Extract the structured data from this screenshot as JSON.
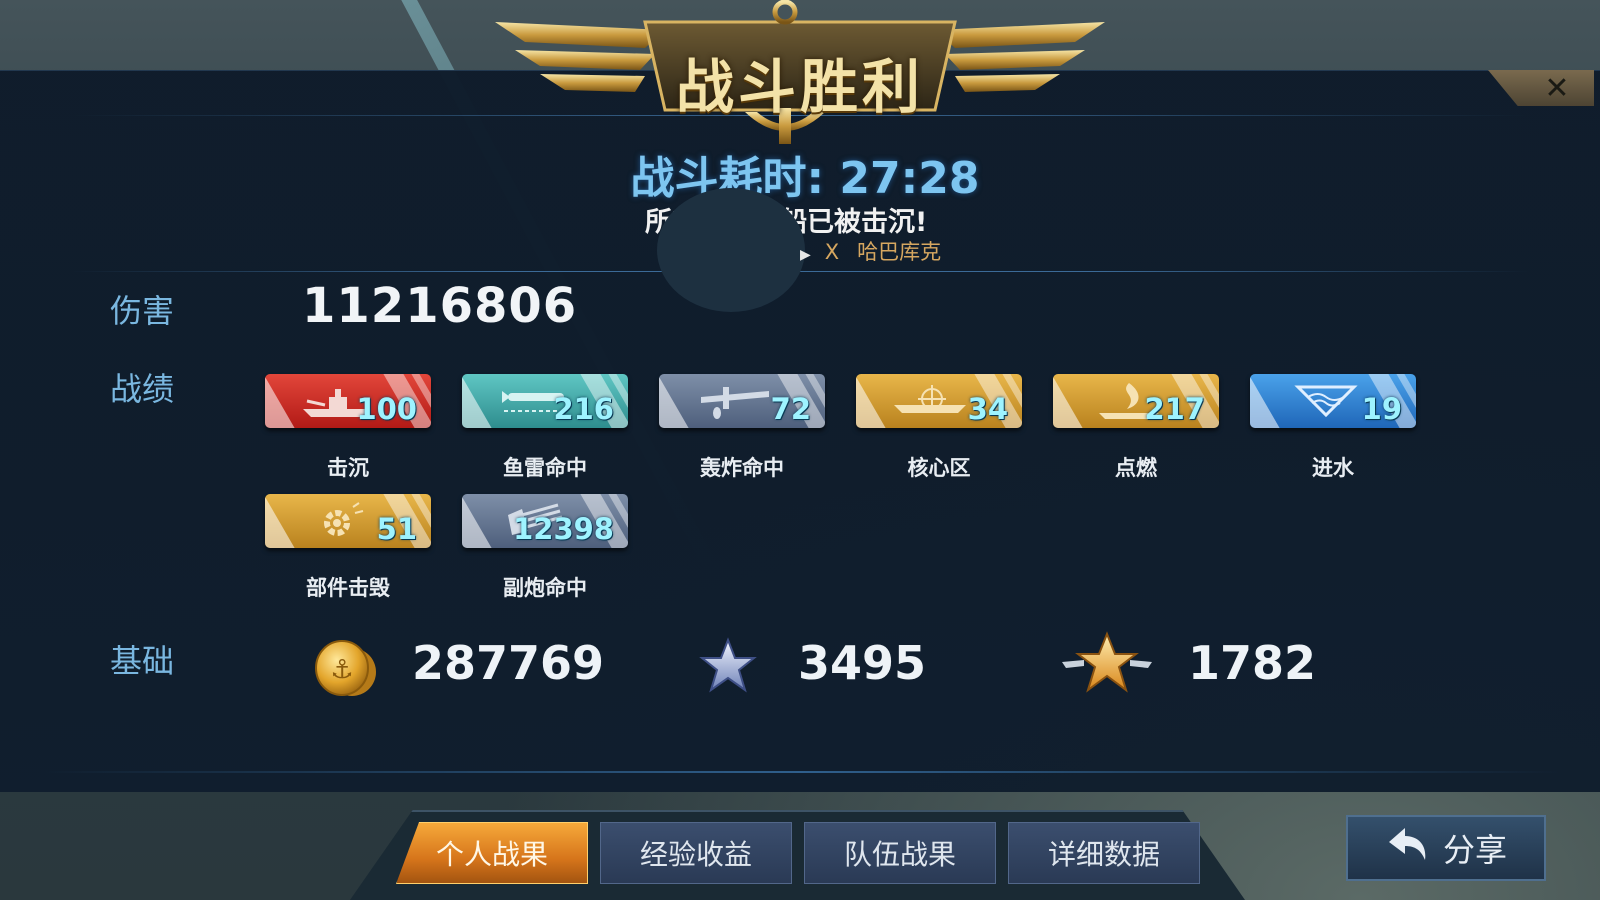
{
  "header": {
    "title": "战斗胜利",
    "duration_text": "战斗耗时: 27:28",
    "sunk_message": "所有敌方舰船已被击沉!",
    "kill_marker": "X",
    "kill_name": "哈巴库克"
  },
  "damage": {
    "label": "伤害",
    "value": "11216806"
  },
  "record": {
    "label": "战绩",
    "badges": [
      {
        "value": "100",
        "caption": "击沉",
        "icon": "warship-icon",
        "color": "#c9302a"
      },
      {
        "value": "216",
        "caption": "鱼雷命中",
        "icon": "torpedo-icon",
        "color": "#3fa5a5"
      },
      {
        "value": "72",
        "caption": "轰炸命中",
        "icon": "bomber-icon",
        "color": "#62738f"
      },
      {
        "value": "34",
        "caption": "核心区",
        "icon": "core-zone-icon",
        "color": "#d29a30"
      },
      {
        "value": "217",
        "caption": "点燃",
        "icon": "fire-icon",
        "color": "#d29a30"
      },
      {
        "value": "19",
        "caption": "进水",
        "icon": "flooding-icon",
        "color": "#2f82d0"
      },
      {
        "value": "51",
        "caption": "部件击毁",
        "icon": "gear-icon",
        "color": "#d29a30"
      },
      {
        "value": "12398",
        "caption": "副炮命中",
        "icon": "secondary-gun-icon",
        "color": "#62738f"
      }
    ]
  },
  "base": {
    "label": "基础",
    "coins": "287769",
    "exp": "3495",
    "rank_exp": "1782"
  },
  "tabs": [
    {
      "label": "个人战果",
      "active": true
    },
    {
      "label": "经验收益",
      "active": false
    },
    {
      "label": "队伍战果",
      "active": false
    },
    {
      "label": "详细数据",
      "active": false
    }
  ],
  "share": {
    "label": "分享"
  }
}
